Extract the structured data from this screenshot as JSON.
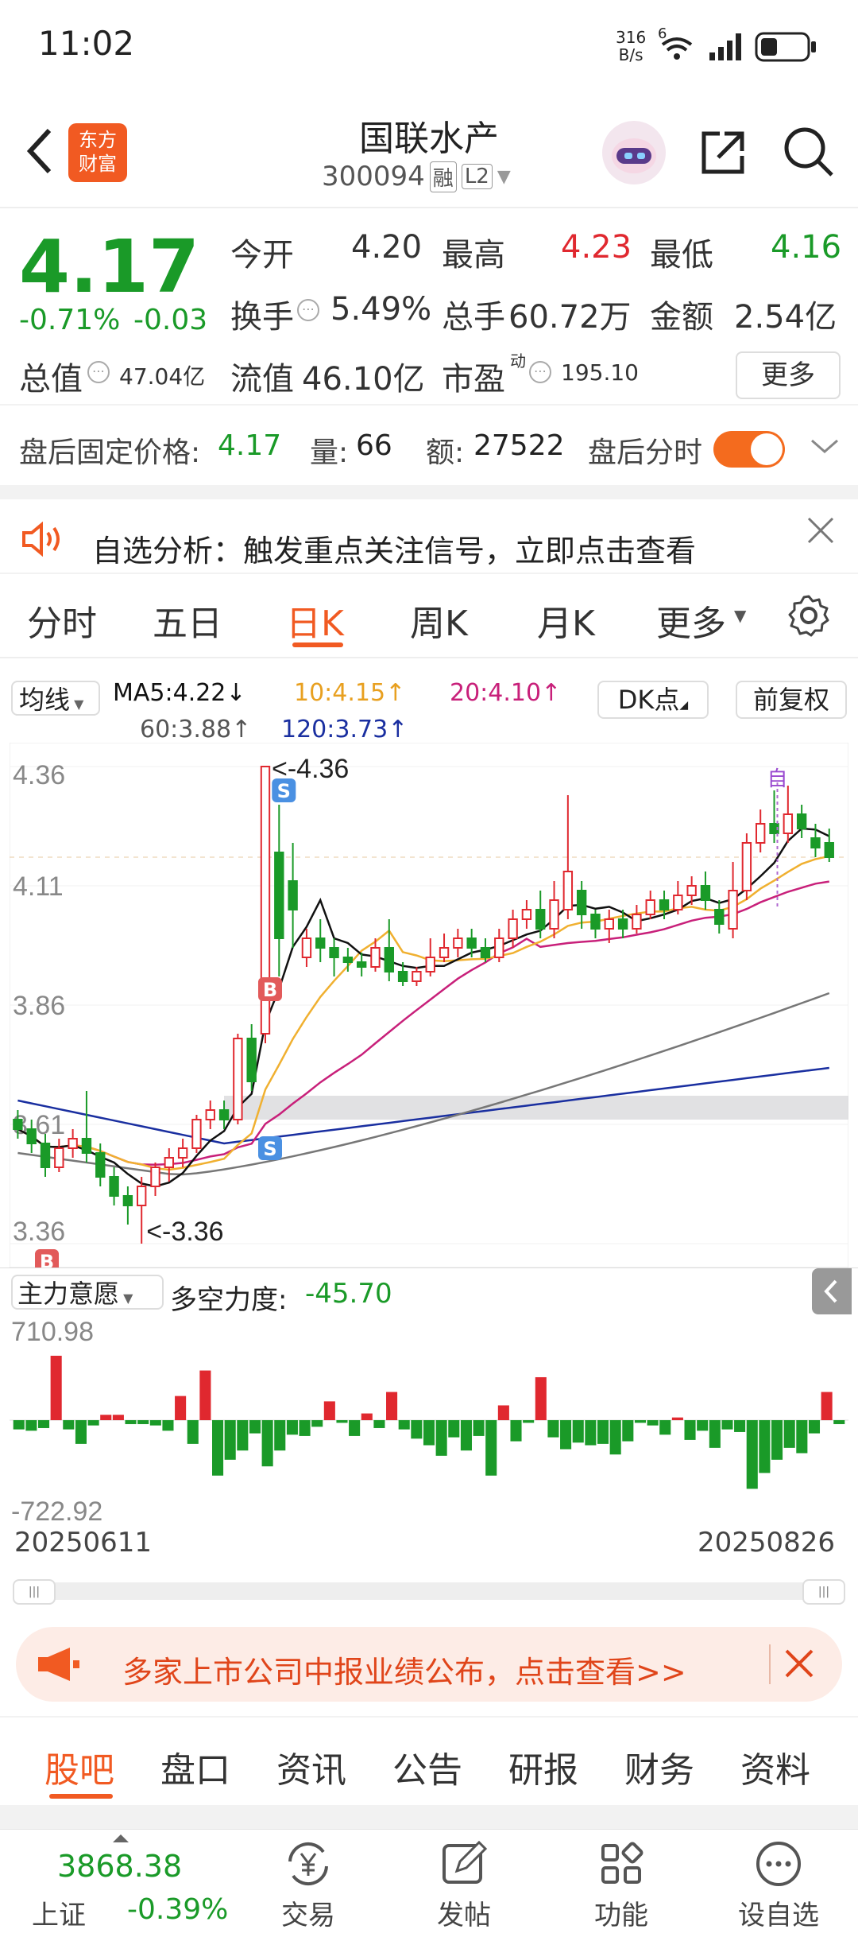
{
  "status_bar": {
    "time": "11:02",
    "net_speed_top": "316",
    "net_speed_bottom": "B/s",
    "signal_label": "6"
  },
  "header": {
    "title": "国联水产",
    "code": "300094",
    "badge_margin": "融",
    "badge_level": "L2",
    "logo_line1": "东方",
    "logo_line2": "财富"
  },
  "quote": {
    "price": "4.17",
    "change_pct": "-0.71%",
    "change_abs": "-0.03",
    "open_label": "今开",
    "open": "4.20",
    "high_label": "最高",
    "high": "4.23",
    "low_label": "最低",
    "low": "4.16",
    "turnover_label": "换手",
    "turnover": "5.49%",
    "volume_label": "总手",
    "volume": "60.72万",
    "amount_label": "金额",
    "amount": "2.54亿",
    "mcap_label": "总值",
    "mcap": "47.04亿",
    "float_label": "流值",
    "float_cap": "46.10亿",
    "pe_label": "市盈",
    "pe_sup": "动",
    "pe": "195.10",
    "more_label": "更多"
  },
  "after_hours": {
    "price_label": "盘后固定价格:",
    "price": "4.17",
    "vol_label": "量:",
    "vol": "66",
    "amt_label": "额:",
    "amt": "27522",
    "toggle_label": "盘后分时"
  },
  "alert": {
    "text": "自选分析：触发重点关注信号，立即点击查看"
  },
  "chart_tabs": {
    "items": [
      "分时",
      "五日",
      "日K",
      "周K",
      "月K",
      "更多"
    ],
    "active": "日K"
  },
  "indicators": {
    "ma_button": "均线",
    "ma5": "MA5:4.22↓",
    "ma10": "10:4.15↑",
    "ma20": "20:4.10↑",
    "ma60": "60:3.88↑",
    "ma120": "120:3.73↑",
    "dk_button": "DK点",
    "adjust_button": "前复权"
  },
  "chart_data": {
    "type": "candlestick",
    "price_axis_labels": [
      "4.36",
      "4.11",
      "3.86",
      "3.61",
      "3.36"
    ],
    "ylim": [
      3.36,
      4.36
    ],
    "high_marker": "4.36",
    "low_marker": "3.36",
    "date_start": "20250611",
    "date_end": "20250826",
    "colors": {
      "up": "#e0282f",
      "down": "#1a9a28",
      "ma5": "#111111",
      "ma10": "#f0b030",
      "ma20": "#c8207a",
      "ma60": "#777777",
      "ma120": "#1a2fa0"
    },
    "candles": [
      [
        3.62,
        3.6,
        3.64,
        3.58
      ],
      [
        3.6,
        3.57,
        3.62,
        3.55
      ],
      [
        3.57,
        3.52,
        3.59,
        3.5
      ],
      [
        3.52,
        3.56,
        3.58,
        3.51
      ],
      [
        3.56,
        3.58,
        3.6,
        3.54
      ],
      [
        3.58,
        3.55,
        3.68,
        3.53
      ],
      [
        3.55,
        3.5,
        3.57,
        3.48
      ],
      [
        3.5,
        3.46,
        3.52,
        3.44
      ],
      [
        3.46,
        3.44,
        3.48,
        3.4
      ],
      [
        3.44,
        3.48,
        3.5,
        3.36
      ],
      [
        3.48,
        3.52,
        3.53,
        3.46
      ],
      [
        3.52,
        3.54,
        3.56,
        3.49
      ],
      [
        3.54,
        3.56,
        3.58,
        3.52
      ],
      [
        3.56,
        3.62,
        3.63,
        3.55
      ],
      [
        3.62,
        3.64,
        3.66,
        3.6
      ],
      [
        3.64,
        3.62,
        3.66,
        3.6
      ],
      [
        3.62,
        3.79,
        3.8,
        3.61
      ],
      [
        3.79,
        3.7,
        3.82,
        3.68
      ],
      [
        3.8,
        4.36,
        4.36,
        3.78
      ],
      [
        4.18,
        4.0,
        4.28,
        3.92
      ],
      [
        4.12,
        4.06,
        4.2,
        3.98
      ],
      [
        3.96,
        4.0,
        4.02,
        3.94
      ],
      [
        4.0,
        3.98,
        4.04,
        3.95
      ],
      [
        3.98,
        3.96,
        4.0,
        3.92
      ],
      [
        3.96,
        3.95,
        3.98,
        3.93
      ],
      [
        3.95,
        3.94,
        3.97,
        3.92
      ],
      [
        3.94,
        3.98,
        4.0,
        3.93
      ],
      [
        3.98,
        3.93,
        4.04,
        3.91
      ],
      [
        3.93,
        3.91,
        3.95,
        3.9
      ],
      [
        3.91,
        3.93,
        3.94,
        3.9
      ],
      [
        3.93,
        3.96,
        4.0,
        3.92
      ],
      [
        3.96,
        3.98,
        4.01,
        3.95
      ],
      [
        3.98,
        4.0,
        4.02,
        3.96
      ],
      [
        4.0,
        3.98,
        4.02,
        3.96
      ],
      [
        3.98,
        3.96,
        4.0,
        3.95
      ],
      [
        3.96,
        4.0,
        4.02,
        3.95
      ],
      [
        4.0,
        4.04,
        4.06,
        3.98
      ],
      [
        4.04,
        4.06,
        4.08,
        4.02
      ],
      [
        4.06,
        4.02,
        4.1,
        4.0
      ],
      [
        4.02,
        4.08,
        4.12,
        4.0
      ],
      [
        4.06,
        4.14,
        4.3,
        4.04
      ],
      [
        4.1,
        4.05,
        4.12,
        4.02
      ],
      [
        4.05,
        4.02,
        4.06,
        4.0
      ],
      [
        4.02,
        4.04,
        4.06,
        3.99
      ],
      [
        4.04,
        4.02,
        4.06,
        4.0
      ],
      [
        4.02,
        4.05,
        4.07,
        4.01
      ],
      [
        4.05,
        4.08,
        4.1,
        4.04
      ],
      [
        4.08,
        4.06,
        4.1,
        4.04
      ],
      [
        4.06,
        4.09,
        4.12,
        4.05
      ],
      [
        4.09,
        4.11,
        4.13,
        4.07
      ],
      [
        4.11,
        4.08,
        4.14,
        4.06
      ],
      [
        4.06,
        4.03,
        4.08,
        4.01
      ],
      [
        4.02,
        4.1,
        4.16,
        4.0
      ],
      [
        4.1,
        4.2,
        4.22,
        4.08
      ],
      [
        4.2,
        4.24,
        4.27,
        4.18
      ],
      [
        4.24,
        4.22,
        4.31,
        4.2
      ],
      [
        4.22,
        4.26,
        4.32,
        4.2
      ],
      [
        4.26,
        4.23,
        4.28,
        4.21
      ],
      [
        4.21,
        4.19,
        4.24,
        4.17
      ],
      [
        4.2,
        4.17,
        4.23,
        4.16
      ]
    ],
    "sub_indicator": {
      "name": "主力意愿",
      "metric_label": "多空力度:",
      "metric_value": "-45.70",
      "max_label": "710.98",
      "min_label": "-722.92",
      "values": [
        -70,
        -80,
        -60,
        480,
        -70,
        -180,
        -40,
        40,
        40,
        -30,
        -30,
        -40,
        -80,
        180,
        -180,
        370,
        -420,
        -300,
        -230,
        -100,
        -350,
        -230,
        -110,
        -120,
        -50,
        140,
        -20,
        -120,
        50,
        -60,
        210,
        -70,
        -140,
        -190,
        -270,
        -130,
        -230,
        -120,
        -420,
        110,
        -160,
        -20,
        320,
        -130,
        -220,
        -170,
        -190,
        -180,
        -260,
        -160,
        -20,
        -40,
        -110,
        20,
        -150,
        -80,
        -210,
        -70,
        -90,
        -520,
        -400,
        -300,
        -210,
        -250,
        -100,
        210,
        -30
      ]
    }
  },
  "scrollbar": {
    "left_handle": "|||",
    "right_handle": "|||"
  },
  "promo": {
    "text": "多家上市公司中报业绩公布，点击查看>>"
  },
  "bottom_tabs": {
    "items": [
      "股吧",
      "盘口",
      "资讯",
      "公告",
      "研报",
      "财务",
      "资料"
    ],
    "active": "股吧"
  },
  "nav": {
    "index_value": "3868.38",
    "index_name": "上证",
    "index_change": "-0.39%",
    "items": [
      "交易",
      "发帖",
      "功能",
      "设自选"
    ]
  }
}
